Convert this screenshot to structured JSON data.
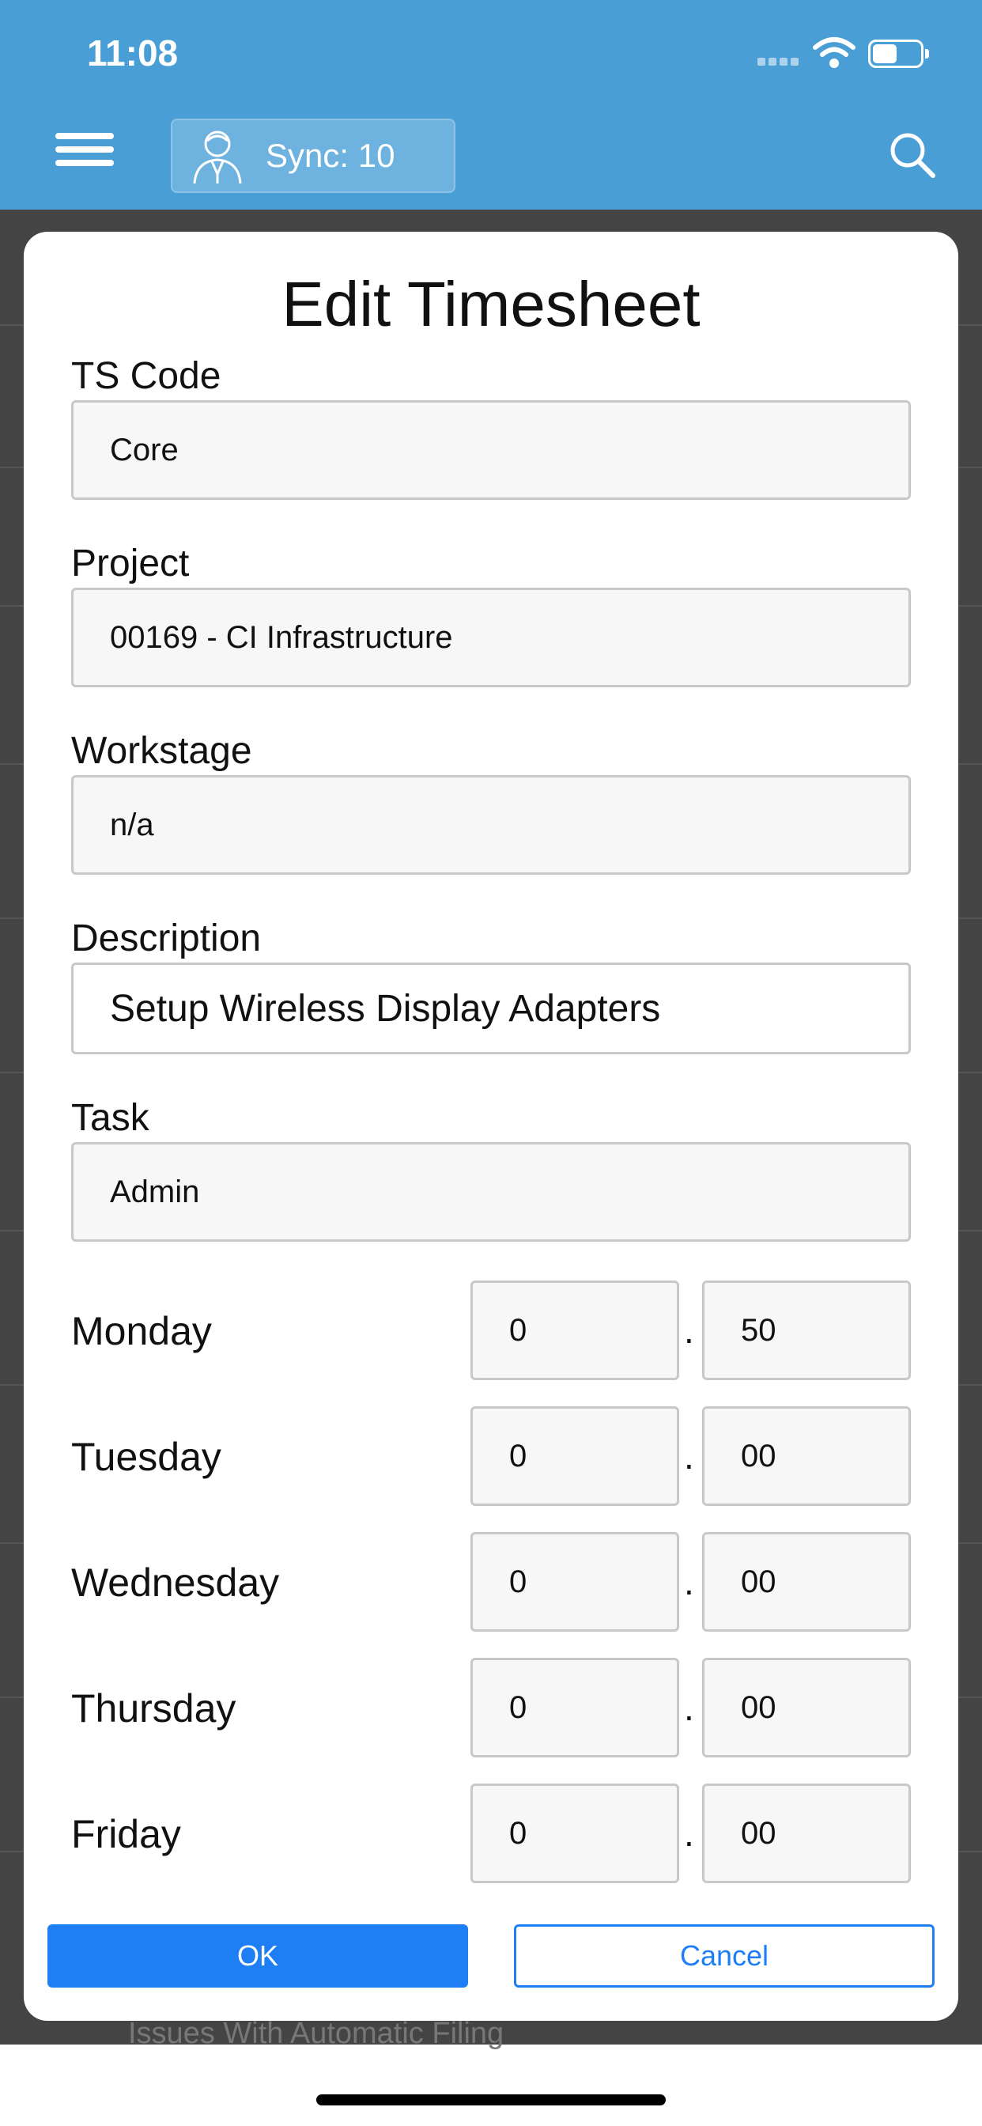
{
  "status_bar": {
    "time": "11:08"
  },
  "header": {
    "sync_label": "Sync: 10",
    "menu_icon": "hamburger-menu-icon",
    "user_icon": "user-icon",
    "search_icon": "search-icon",
    "bar_color": "#4a9ed6"
  },
  "modal": {
    "title": "Edit Timesheet",
    "fields": {
      "ts_code": {
        "label": "TS Code",
        "value": "Core"
      },
      "project": {
        "label": "Project",
        "value": "00169 - CI Infrastructure"
      },
      "workstage": {
        "label": "Workstage",
        "value": "n/a"
      },
      "description": {
        "label": "Description",
        "value": "Setup Wireless Display Adapters"
      },
      "task": {
        "label": "Task",
        "value": "Admin"
      }
    },
    "days": [
      {
        "label": "Monday",
        "hours": "0",
        "minutes": "50"
      },
      {
        "label": "Tuesday",
        "hours": "0",
        "minutes": "00"
      },
      {
        "label": "Wednesday",
        "hours": "0",
        "minutes": "00"
      },
      {
        "label": "Thursday",
        "hours": "0",
        "minutes": "00"
      },
      {
        "label": "Friday",
        "hours": "0",
        "minutes": "00"
      }
    ],
    "separator": ".",
    "ok_label": "OK",
    "cancel_label": "Cancel",
    "accent_color": "#1e7ff5"
  },
  "background": {
    "partial_text": "Issues With Automatic Filing"
  }
}
